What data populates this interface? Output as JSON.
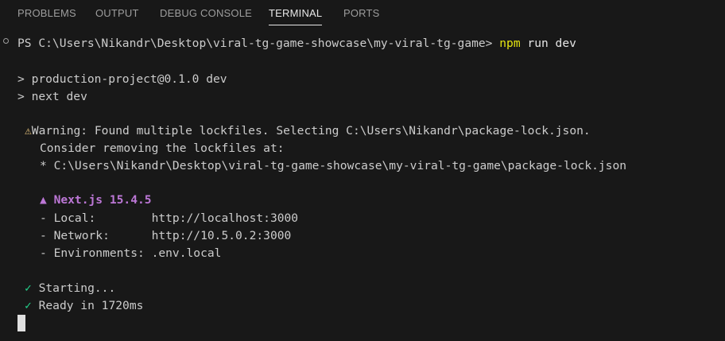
{
  "tabs": [
    {
      "label": "PROBLEMS"
    },
    {
      "label": "OUTPUT"
    },
    {
      "label": "DEBUG CONSOLE"
    },
    {
      "label": "TERMINAL"
    },
    {
      "label": "PORTS"
    }
  ],
  "active_tab": "TERMINAL",
  "terminal": {
    "prompt": "PS C:\\Users\\Nikandr\\Desktop\\viral-tg-game-showcase\\my-viral-tg-game>",
    "command_npm": "npm",
    "command_args": " run dev",
    "script_line1": "> production-project@0.1.0 dev",
    "script_line2": "> next dev",
    "warning_icon": "⚠",
    "warning_line1": "Warning: Found multiple lockfiles. Selecting C:\\Users\\Nikandr\\package-lock.json.",
    "warning_line2": "Consider removing the lockfiles at:",
    "warning_line3": "* C:\\Users\\Nikandr\\Desktop\\viral-tg-game-showcase\\my-viral-tg-game\\package-lock.json",
    "next_title": "▲ Next.js 15.4.5",
    "local_line": "- Local:        http://localhost:3000",
    "network_line": "- Network:      http://10.5.0.2:3000",
    "env_line": "- Environments: .env.local",
    "check_icon": "✓",
    "starting_text": "Starting...",
    "ready_text": "Ready in 1720ms"
  },
  "colors": {
    "background": "#181818",
    "text": "#cccccc",
    "npm_command": "#e5e510",
    "nextjs": "#bc77d6",
    "check": "#23d18b",
    "warning": "#e5c07b"
  }
}
